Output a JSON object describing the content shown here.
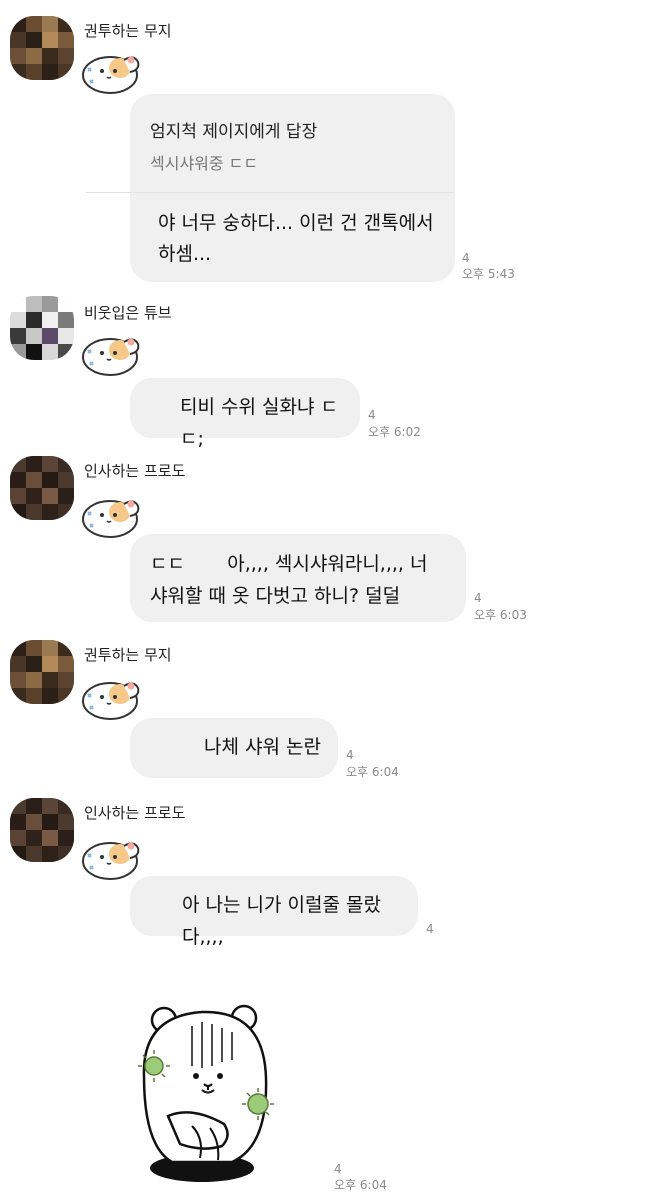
{
  "messages": [
    {
      "sender": "권투하는 무지",
      "reply_to": "엄지척 제이지에게 답장",
      "quoted": "섹시샤워중 ㄷㄷ",
      "text": "야 너무 숭하다... 이런 건 갠톡에서 하셈...",
      "unread": "4",
      "time": "오후 5:43"
    },
    {
      "sender": "비웃입은 튜브",
      "text": "티비 수위 실화냐 ㄷㄷ;",
      "unread": "4",
      "time": "오후 6:02"
    },
    {
      "sender": "인사하는 프로도",
      "text": "ㄷㄷ       아,,,, 섹시샤워라니,,,, 너 샤워할 때 옷 다벗고 하니? 덜덜",
      "unread": "4",
      "time": "오후 6:03"
    },
    {
      "sender": "권투하는 무지",
      "text": "나체 샤워 논란",
      "unread": "4",
      "time": "오후 6:04"
    },
    {
      "sender": "인사하는 프로도",
      "text": "아 나는 니가 이럴줄 몰랐다,,,,",
      "unread": "4",
      "time": ""
    }
  ],
  "final_sticker": {
    "unread": "4",
    "time": "오후 6:04"
  },
  "colors": {
    "bubble": "#f0f0f0",
    "meta_text": "#8a8a8a",
    "sticker_orange": "#f6c98a",
    "sticker_blue": "#8fb7e6",
    "sticker_green": "#9ccb7a"
  },
  "icons": [
    "profile-avatar",
    "hamster-sticker",
    "bear-sticker"
  ]
}
